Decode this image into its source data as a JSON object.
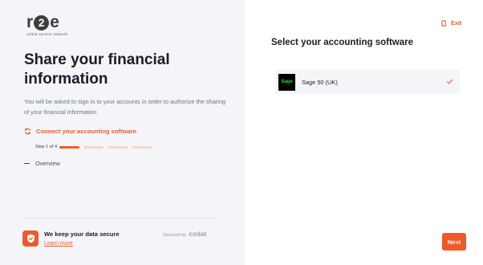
{
  "brand": {
    "logo_r": "r",
    "logo_2": "2",
    "logo_e": "e",
    "tagline": "online service network"
  },
  "left": {
    "title": "Share your financial information",
    "description": "You will be asked to sign in to your accounts in order to authorize the sharing of your financial information",
    "current_step": {
      "icon": "sync-icon",
      "label": "Connect your accounting software",
      "step_count": "Step 1 of 4",
      "progress": 0.25
    },
    "next_step": {
      "label": "Overview"
    },
    "security": {
      "icon": "shield-icon",
      "title": "We keep your data secure",
      "learn_more": "Learn more",
      "secured_by": "Secured by",
      "provider": "codat"
    }
  },
  "right": {
    "exit_label": "Exit",
    "title": "Select your accounting software",
    "software": [
      {
        "logo_text": "Sage",
        "name": "Sage 50 (UK)",
        "selected": true
      }
    ],
    "next_label": "Next"
  },
  "colors": {
    "accent": "#ef5a2a",
    "panel_bg": "#f3f5f9",
    "text_dark": "#1c1c28"
  }
}
